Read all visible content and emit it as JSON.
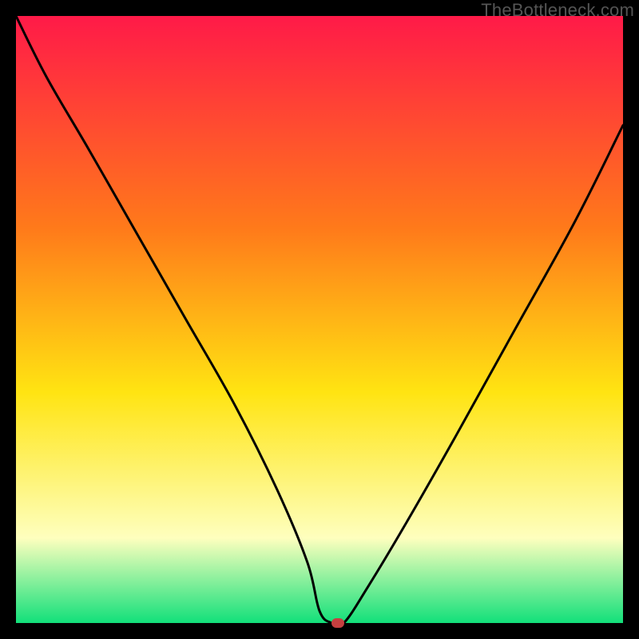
{
  "watermark": "TheBottleneck.com",
  "colors": {
    "red": "#ff1a48",
    "orange": "#ff7a1a",
    "yellow": "#ffe412",
    "pale": "#feffbe",
    "green": "#12e07a",
    "marker": "#c64040",
    "curve": "#000000"
  },
  "chart_data": {
    "type": "line",
    "title": "",
    "xlabel": "",
    "ylabel": "",
    "xlim": [
      0,
      100
    ],
    "ylim": [
      0,
      100
    ],
    "grid": false,
    "legend": false,
    "series": [
      {
        "name": "bottleneck-curve",
        "x": [
          0,
          5,
          12,
          20,
          28,
          36,
          43,
          48,
          50,
          52,
          54,
          58,
          64,
          72,
          82,
          92,
          100
        ],
        "values": [
          100,
          90,
          78,
          64,
          50,
          36,
          22,
          10,
          2,
          0,
          0,
          6,
          16,
          30,
          48,
          66,
          82
        ]
      }
    ],
    "marker": {
      "x": 53,
      "y": 0
    },
    "gradient_stops": [
      {
        "pos": 0,
        "color_key": "red"
      },
      {
        "pos": 35,
        "color_key": "orange"
      },
      {
        "pos": 62,
        "color_key": "yellow"
      },
      {
        "pos": 86,
        "color_key": "pale"
      },
      {
        "pos": 100,
        "color_key": "green"
      }
    ]
  }
}
